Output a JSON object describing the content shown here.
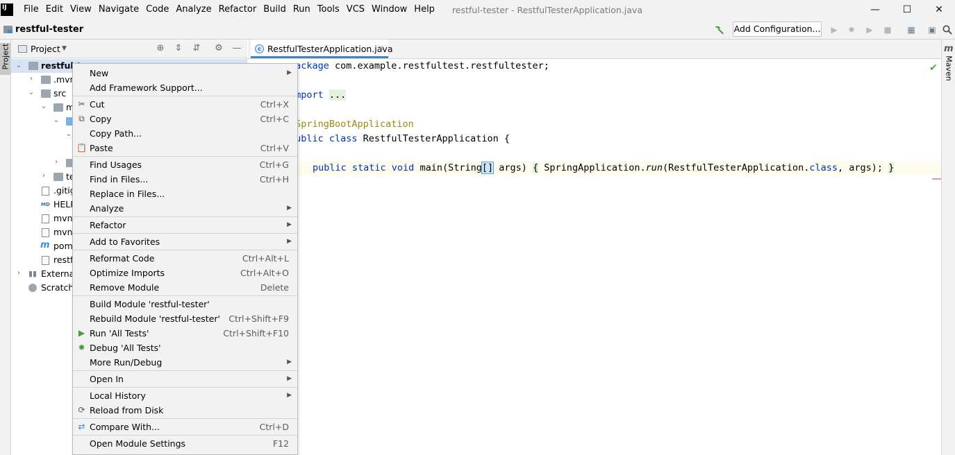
{
  "menubar": {
    "logo_text": "IJ",
    "items": [
      "File",
      "Edit",
      "View",
      "Navigate",
      "Code",
      "Analyze",
      "Refactor",
      "Build",
      "Run",
      "Tools",
      "VCS",
      "Window",
      "Help"
    ],
    "window_title": "restful-tester - RestfulTesterApplication.java"
  },
  "navbar": {
    "project_name": "restful-tester",
    "add_configuration_label": "Add Configuration..."
  },
  "left_strip": {
    "project_label": "Project"
  },
  "right_strip": {
    "maven_icon": "m",
    "maven_label": "Maven"
  },
  "project_panel": {
    "title": "Project",
    "tree": [
      {
        "label": "restful-t",
        "depth": 0
      },
      {
        "label": ".mvn",
        "depth": 1
      },
      {
        "label": "src",
        "depth": 1
      },
      {
        "label": "m",
        "depth": 2
      },
      {
        "label": "",
        "depth": 3
      },
      {
        "label": "",
        "depth": 4
      },
      {
        "label": "",
        "depth": 3
      },
      {
        "label": "te",
        "depth": 2
      },
      {
        "label": ".gitig",
        "depth": 1
      },
      {
        "label": "HELP",
        "depth": 1
      },
      {
        "label": "mvnv",
        "depth": 1
      },
      {
        "label": "mvnv",
        "depth": 1
      },
      {
        "label": "pom.",
        "depth": 1
      },
      {
        "label": "restfu",
        "depth": 1
      },
      {
        "label": "External",
        "depth": 0
      },
      {
        "label": "Scratche",
        "depth": 0
      }
    ]
  },
  "editor": {
    "tab_label": "RestfulTesterApplication.java",
    "lines": {
      "l1_kw": "package",
      "l1_rest": " com.example.restfultest.restfultester;",
      "l3_kw": "import",
      "l3_fold": "...",
      "l5_ann": "@SpringBootApplication",
      "l6_kw": "public class",
      "l6_rest": " RestfulTesterApplication {",
      "l8_kw": "public static void",
      "l8_a": " main(String",
      "l8_br": "[]",
      "l8_b": " args) ",
      "l8_fold_open": "{",
      "l8_c": " SpringApplication.",
      "l8_run": "run",
      "l8_d": "(RestfulTesterApplication.",
      "l8_class": "class",
      "l8_e": ", args); ",
      "l8_fold_close": "}"
    }
  },
  "context_menu": {
    "items": [
      {
        "label": "New",
        "shortcut": "",
        "submenu": true
      },
      {
        "label": "Add Framework Support...",
        "shortcut": "",
        "submenu": false
      },
      {
        "label": "Cut",
        "shortcut": "Ctrl+X",
        "submenu": false,
        "icon": "scissors-icon"
      },
      {
        "label": "Copy",
        "shortcut": "Ctrl+C",
        "submenu": false,
        "icon": "copy-icon"
      },
      {
        "label": "Copy Path...",
        "shortcut": "",
        "submenu": false
      },
      {
        "label": "Paste",
        "shortcut": "Ctrl+V",
        "submenu": false,
        "icon": "paste-icon"
      },
      {
        "label": "Find Usages",
        "shortcut": "Ctrl+G",
        "submenu": false
      },
      {
        "label": "Find in Files...",
        "shortcut": "Ctrl+H",
        "submenu": false
      },
      {
        "label": "Replace in Files...",
        "shortcut": "",
        "submenu": false
      },
      {
        "label": "Analyze",
        "shortcut": "",
        "submenu": true
      },
      {
        "label": "Refactor",
        "shortcut": "",
        "submenu": true
      },
      {
        "label": "Add to Favorites",
        "shortcut": "",
        "submenu": true
      },
      {
        "label": "Reformat Code",
        "shortcut": "Ctrl+Alt+L",
        "submenu": false
      },
      {
        "label": "Optimize Imports",
        "shortcut": "Ctrl+Alt+O",
        "submenu": false
      },
      {
        "label": "Remove Module",
        "shortcut": "Delete",
        "submenu": false
      },
      {
        "label": "Build Module 'restful-tester'",
        "shortcut": "",
        "submenu": false
      },
      {
        "label": "Rebuild Module 'restful-tester'",
        "shortcut": "Ctrl+Shift+F9",
        "submenu": false
      },
      {
        "label": "Run 'All Tests'",
        "shortcut": "Ctrl+Shift+F10",
        "submenu": false,
        "icon": "run-icon"
      },
      {
        "label": "Debug 'All Tests'",
        "shortcut": "",
        "submenu": false,
        "icon": "debug-icon"
      },
      {
        "label": "More Run/Debug",
        "shortcut": "",
        "submenu": true
      },
      {
        "label": "Open In",
        "shortcut": "",
        "submenu": true
      },
      {
        "label": "Local History",
        "shortcut": "",
        "submenu": true
      },
      {
        "label": "Reload from Disk",
        "shortcut": "",
        "submenu": false,
        "icon": "reload-icon"
      },
      {
        "label": "Compare With...",
        "shortcut": "Ctrl+D",
        "submenu": false,
        "icon": "compare-icon"
      },
      {
        "label": "Open Module Settings",
        "shortcut": "F12",
        "submenu": false
      }
    ]
  },
  "colors": {
    "keyword": "#0033b3",
    "annotation": "#9e880d",
    "run_green": "#4e9a3f",
    "selection": "#d5e3f5"
  }
}
